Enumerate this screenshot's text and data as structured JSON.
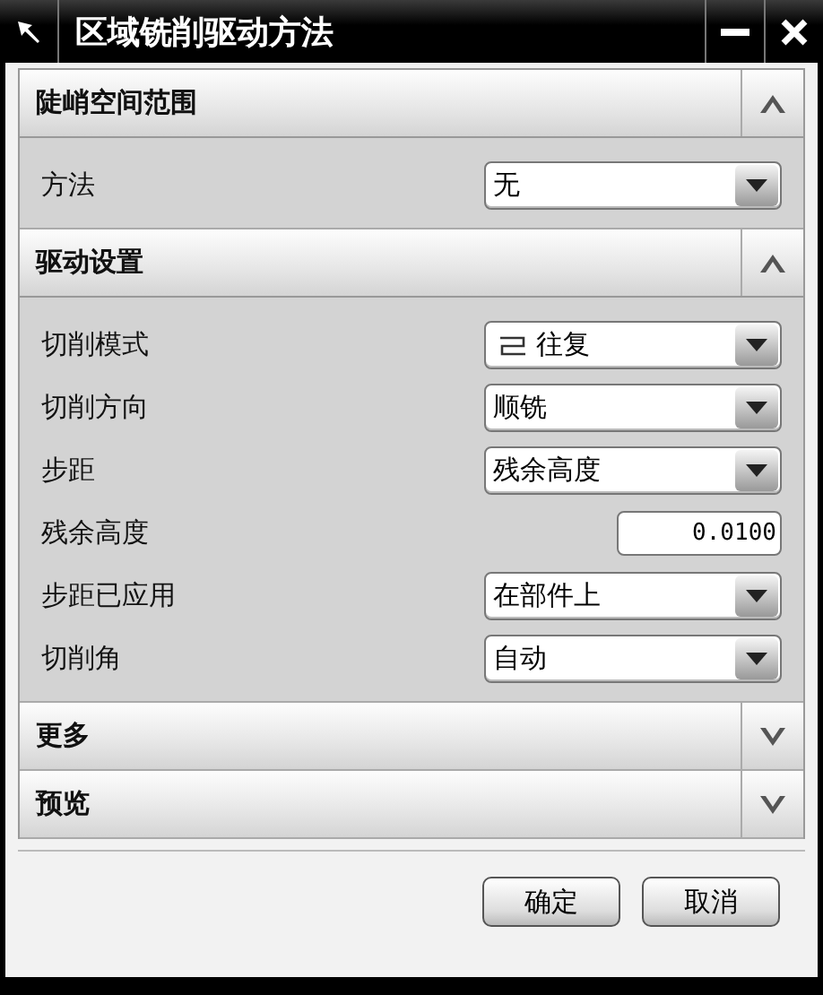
{
  "window": {
    "title": "区域铣削驱动方法"
  },
  "sections": [
    {
      "title": "陡峭空间范围",
      "expanded": true,
      "rows": [
        {
          "kind": "dropdown",
          "label": "方法",
          "value": "无"
        }
      ]
    },
    {
      "title": "驱动设置",
      "expanded": true,
      "rows": [
        {
          "kind": "icon-dropdown",
          "label": "切削模式",
          "value": "往复"
        },
        {
          "kind": "dropdown",
          "label": "切削方向",
          "value": "顺铣"
        },
        {
          "kind": "dropdown",
          "label": "步距",
          "value": "残余高度"
        },
        {
          "kind": "number",
          "label": "残余高度",
          "value": "0.0100"
        },
        {
          "kind": "dropdown",
          "label": "步距已应用",
          "value": "在部件上"
        },
        {
          "kind": "dropdown",
          "label": "切削角",
          "value": "自动"
        }
      ]
    },
    {
      "title": "更多",
      "expanded": false
    },
    {
      "title": "预览",
      "expanded": false
    }
  ],
  "buttons": [
    "确定",
    "取消"
  ]
}
